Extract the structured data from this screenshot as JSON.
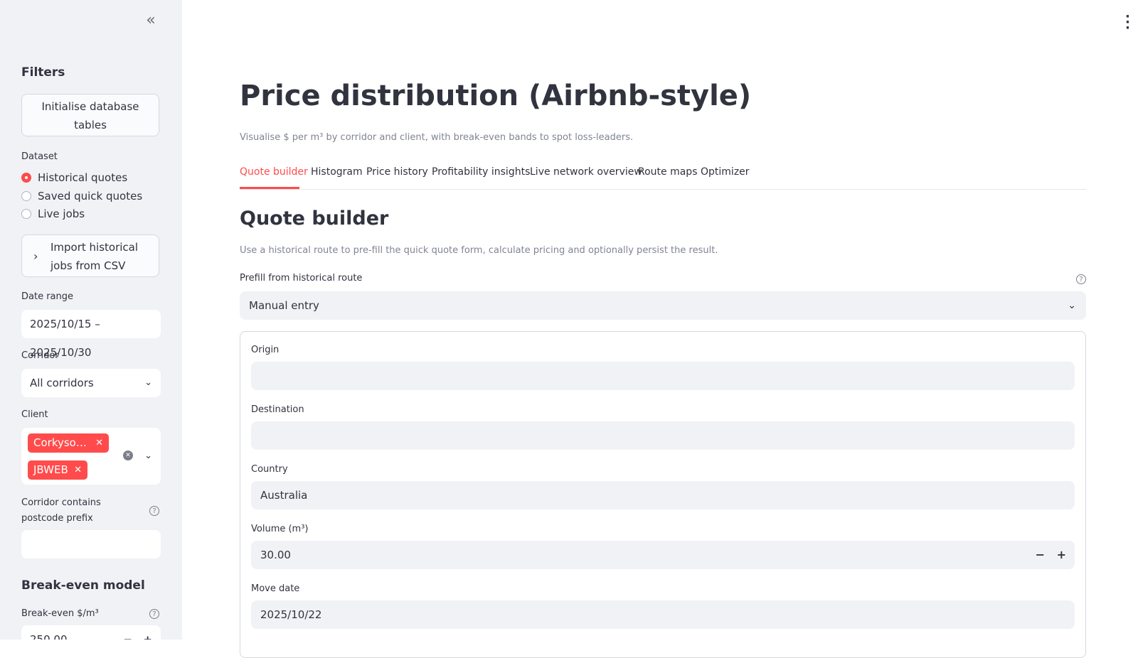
{
  "sidebar": {
    "collapse_glyph": "«",
    "filters_heading": "Filters",
    "init_db_button": "Initialise database tables",
    "dataset_label": "Dataset",
    "dataset_options": [
      {
        "label": "Historical quotes",
        "selected": true
      },
      {
        "label": "Saved quick quotes",
        "selected": false
      },
      {
        "label": "Live jobs",
        "selected": false
      }
    ],
    "import_expander": "Import historical jobs from CSV",
    "date_range_label": "Date range",
    "date_range_value": "2025/10/15 – 2025/10/30",
    "corridor_label": "Corridor",
    "corridor_value": "All corridors",
    "client_label": "Client",
    "client_chips": [
      "Corkyso…",
      "JBWEB"
    ],
    "postcode_label": "Corridor contains postcode prefix",
    "postcode_value": "",
    "break_even_heading": "Break-even model",
    "break_even_label": "Break-even $/m³",
    "break_even_value": "250.00"
  },
  "main": {
    "title": "Price distribution (Airbnb-style)",
    "subtitle": "Visualise $ per m³ by corridor and client, with break-even bands to spot loss-leaders.",
    "tabs": [
      {
        "label": "Quote builder",
        "active": true
      },
      {
        "label": "Histogram",
        "active": false
      },
      {
        "label": "Price history",
        "active": false
      },
      {
        "label": "Profitability insights",
        "active": false
      },
      {
        "label": "Live network overview",
        "active": false
      },
      {
        "label": "Route maps",
        "active": false
      },
      {
        "label": "Optimizer",
        "active": false
      }
    ],
    "section_heading": "Quote builder",
    "section_description": "Use a historical route to pre-fill the quick quote form, calculate pricing and optionally persist the result.",
    "prefill_label": "Prefill from historical route",
    "prefill_value": "Manual entry",
    "form": {
      "origin_label": "Origin",
      "origin_value": "",
      "destination_label": "Destination",
      "destination_value": "",
      "country_label": "Country",
      "country_value": "Australia",
      "volume_label": "Volume (m³)",
      "volume_value": "30.00",
      "move_date_label": "Move date",
      "move_date_value": "2025/10/22"
    }
  },
  "colors": {
    "accent": "#ff4b4b",
    "sidebar_bg": "#f0f2f6",
    "input_bg": "#f0f2f6",
    "muted_text": "#808495"
  },
  "icons": [
    "double-chevron-left-icon",
    "kebab-menu-icon",
    "chevron-down-icon",
    "help-circle-icon",
    "clear-icon",
    "chevron-right-icon"
  ]
}
